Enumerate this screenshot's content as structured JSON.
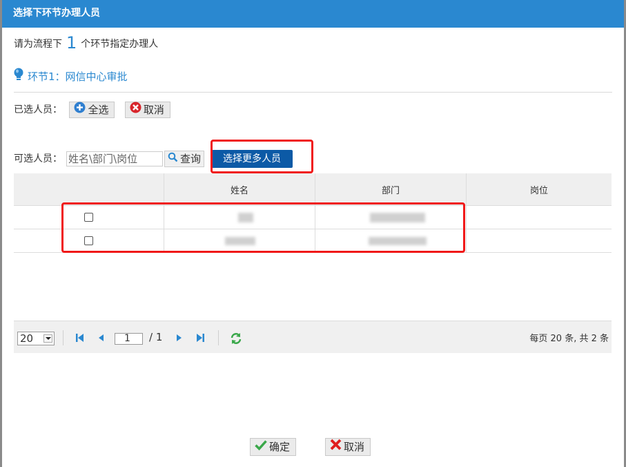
{
  "dialog": {
    "title": "选择下环节办理人员"
  },
  "instruction": {
    "prefix": "请为流程下",
    "count": "1",
    "suffix": "个环节指定办理人"
  },
  "node": {
    "label": "环节1：网信中心审批"
  },
  "selected": {
    "label": "已选人员：",
    "select_all": "全选",
    "cancel": "取消"
  },
  "available": {
    "label": "可选人员：",
    "search_placeholder": "姓名\\部门\\岗位",
    "query": "查询",
    "more": "选择更多人员"
  },
  "table": {
    "headers": [
      "",
      "姓名",
      "部门",
      "岗位"
    ],
    "row_count": 2
  },
  "pager": {
    "page_size": "20",
    "current_page": "1",
    "total_pages": "/ 1",
    "info": "每页 20 条, 共 2 条"
  },
  "footer": {
    "ok": "确定",
    "cancel": "取消"
  },
  "colors": {
    "accent": "#2a88d0",
    "primary_button": "#0c5aa6",
    "highlight": "#f01818"
  }
}
